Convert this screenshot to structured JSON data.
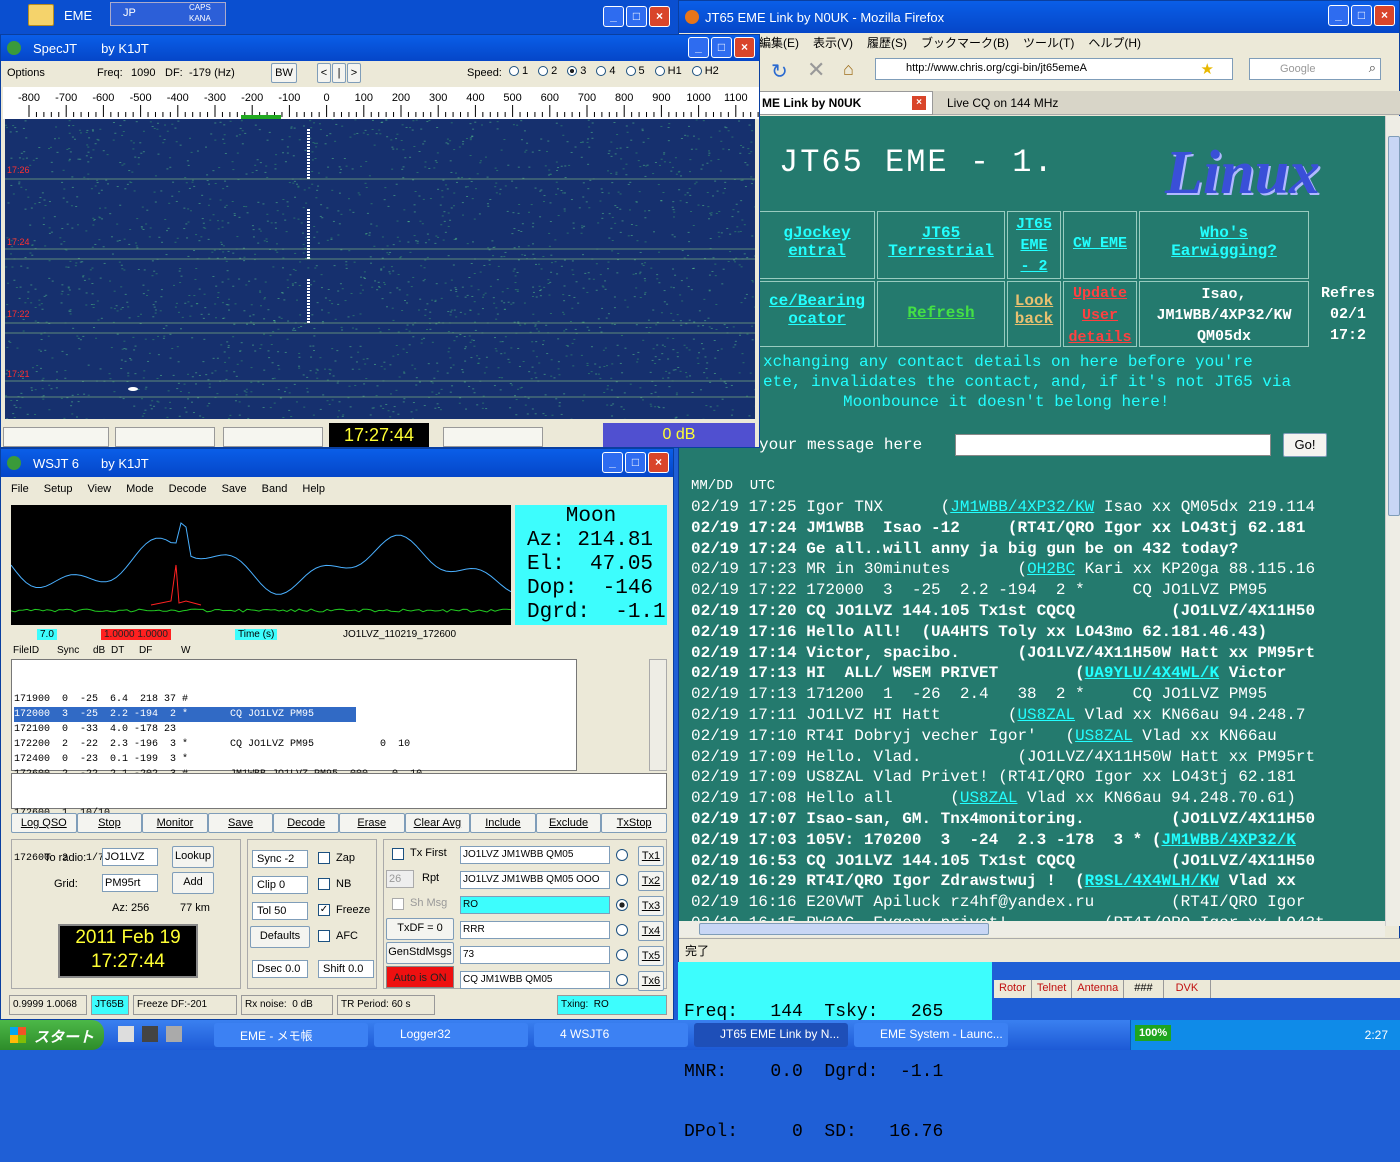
{
  "eme": {
    "title": "EME",
    "ime": {
      "lang": "JP",
      "caps": "CAPS",
      "kana": "KANA"
    }
  },
  "spec": {
    "title": "SpecJT",
    "by": "by K1JT",
    "options": "Options",
    "freq_label": "Freq:",
    "freq": "1090",
    "df_label": "DF:",
    "df": "-179 (Hz)",
    "bw": "BW",
    "speed": "Speed:",
    "speed_opts": [
      "1",
      "2",
      "3",
      "4",
      "5",
      "H1",
      "H2"
    ],
    "ticks": [
      "-800",
      "-700",
      "-600",
      "-500",
      "-400",
      "-300",
      "-200",
      "-100",
      "0",
      "100",
      "200",
      "300",
      "400",
      "500",
      "600",
      "700",
      "800",
      "900",
      "1000",
      "1100"
    ],
    "time_marks": [
      "17:26",
      "17:24",
      "17:22",
      "17:21"
    ],
    "clock": "17:27:44",
    "db": "0 dB"
  },
  "wsjt": {
    "title": "WSJT 6",
    "by": "by K1JT",
    "menu": [
      "File",
      "Setup",
      "View",
      "Mode",
      "Decode",
      "Save",
      "Band",
      "Help"
    ],
    "moon": {
      "title": "Moon",
      "az": "Az: 214.81",
      "el": "El:  47.05",
      "dop": "Dop:  -146",
      "dgrd": "Dgrd:  -1.1"
    },
    "status1": {
      "a": "7.0",
      "b": "1.0000  1.0000",
      "c": "Time (s)",
      "file": "JO1LVZ_110219_172600"
    },
    "headers": [
      "FileID",
      "Sync",
      "dB",
      "DT",
      "DF",
      "W"
    ],
    "rows": [
      "171900  0  -25  6.4  218 37 #",
      "172000  3  -25  2.2 -194  2 *       CQ JO1LVZ PM95           0  10",
      "172100  0  -33  4.0 -178 23",
      "172200  2  -22  2.3 -196  3 *       CQ JO1LVZ PM95           0  10",
      "172400  0  -23  0.1 -199  3 *",
      "172600  2  -22  2.1 -202  3 #       JM1WBB JO1LVZ PM95  000    0  10"
    ],
    "avg": [
      "172600  1  10/10",
      "172600  2   1/7"
    ],
    "buttons": [
      "Log QSO",
      "Stop",
      "Monitor",
      "Save",
      "Decode",
      "Erase",
      "Clear Avg",
      "Include",
      "Exclude",
      "TxStop"
    ],
    "to_radio_label": "To radio:",
    "to_radio": "JO1LVZ",
    "lookup": "Lookup",
    "grid_label": "Grid:",
    "grid": "PM95rt",
    "add": "Add",
    "az": "Az: 256",
    "km": "77 km",
    "date": "2011 Feb 19",
    "time": "17:27:44",
    "sync": "Sync  -2",
    "clip": "Clip  0",
    "tol": "Tol   50",
    "defaults": "Defaults",
    "dsec": "Dsec  0.0",
    "shift": "Shift 0.0",
    "zap": "Zap",
    "nb": "NB",
    "freeze": "Freeze",
    "afc": "AFC",
    "txfirst": "Tx First",
    "rpt_val": "26",
    "rpt": "Rpt",
    "shmsg": "Sh Msg",
    "txdf": "TxDF = 0",
    "genstd": "GenStdMsgs",
    "autoon": "Auto is ON",
    "tx": [
      "JO1LVZ JM1WBB QM05",
      "JO1LVZ JM1WBB QM05 OOO",
      "RO",
      "RRR",
      "73",
      "CQ JM1WBB QM05"
    ],
    "txlabels": [
      "Tx1",
      "Tx2",
      "Tx3",
      "Tx4",
      "Tx5",
      "Tx6"
    ],
    "bottom": [
      "0.9999 1.0068",
      "JT65B",
      "Freeze DF:-201",
      "Rx noise:  0 dB",
      "TR Period: 60 s",
      "Txing:  RO"
    ]
  },
  "ff": {
    "title": "JT65 EME Link by N0UK - Mozilla Firefox",
    "menu": [
      "編集(E)",
      "表示(V)",
      "履歴(S)",
      "ブックマーク(B)",
      "ツール(T)",
      "ヘルプ(H)"
    ],
    "url": "http://www.chris.org/cgi-bin/jt65emeA",
    "search": "Google",
    "tab1": "ME Link by N0UK",
    "tab2": "Live CQ on 144 MHz",
    "heading": "JT65 EME - 1.",
    "logo": "Linux",
    "nav1": [
      "gJockey\nentral",
      "JT65\nTerrestrial",
      "JT65\nEME\n- 2",
      "CW EME",
      "Who's\nEarwigging?"
    ],
    "nav2": [
      "ce/Bearing\nocator",
      "Refresh",
      "Look\nback",
      "Update\nUser\ndetails"
    ],
    "user": "Isao,\nJM1WBB/4XP32/KW\nQM05dx",
    "refresh": "Refres\n02/1\n17:2",
    "warn1": "xchanging any contact details on here before you're",
    "warn2": "ete, invalidates the contact, and, if it's not JT65 via",
    "warn3": "Moonbounce it doesn't belong here!",
    "msg_label": "your message here",
    "go": "Go!",
    "col_header": "MM/DD  UTC",
    "log": [
      [
        "02/19 17:25 Igor TNX      (",
        "JM1WBB/4XP32/KW",
        " Isao xx QM05dx 219.114"
      ],
      [
        "02/19 17:24 JM1WBB  Isao -12     (RT4I/QRO Igor xx LO43tj 62.181",
        "",
        ""
      ],
      [
        "02/19 17:24 Ge all..will anny ja big gun be on 432 today?",
        "",
        ""
      ],
      [
        "02/19 17:23 MR in 30minutes       (",
        "OH2BC",
        " Kari xx KP20ga 88.115.16"
      ],
      [
        "02/19 17:22 172000  3  -25  2.2 -194  2 *     CQ JO1LVZ PM95",
        "",
        ""
      ],
      [
        "02/19 17:20 CQ JO1LVZ 144.105 Tx1st CQCQ          (JO1LVZ/4X11H50",
        "",
        ""
      ],
      [
        "02/19 17:16 Hello All!  (UA4HTS Toly xx LO43mo 62.181.46.43)",
        "",
        ""
      ],
      [
        "02/19 17:14 Victor, spacibo.      (JO1LVZ/4X11H50W Hatt xx PM95rt",
        "",
        ""
      ],
      [
        "02/19 17:13 HI  ALL/ WSEM PRIVET        (",
        "UA9YLU/4X4WL/K",
        " Victor"
      ],
      [
        "02/19 17:13 171200  1  -26  2.4   38  2 *     CQ JO1LVZ PM95",
        "",
        ""
      ],
      [
        "02/19 17:11 JO1LVZ HI Hatt       (",
        "US8ZAL",
        " Vlad xx KN66au 94.248.7"
      ],
      [
        "02/19 17:10 RT4I Dobryj vecher Igor'   (",
        "US8ZAL",
        " Vlad xx KN66au"
      ],
      [
        "02/19 17:09 Hello. Vlad.          (JO1LVZ/4X11H50W Hatt xx PM95rt",
        "",
        ""
      ],
      [
        "02/19 17:09 US8ZAL Vlad Privet! (RT4I/QRO Igor xx LO43tj 62.181",
        "",
        ""
      ],
      [
        "02/19 17:08 Hello all      (",
        "US8ZAL",
        " Vlad xx KN66au 94.248.70.61)"
      ],
      [
        "02/19 17:07 Isao-san, GM. Tnx4monitoring.         (JO1LVZ/4X11H50",
        "",
        ""
      ],
      [
        "02/19 17:03 105V: 170200  3  -24  2.3 -178  3 * (",
        "JM1WBB/4XP32/K",
        ""
      ],
      [
        "02/19 16:53 CQ JO1LVZ 144.105 Tx1st CQCQ          (JO1LVZ/4X11H50",
        "",
        ""
      ],
      [
        "02/19 16:29 RT4I/QRO Igor Zdrawstwuj !  (",
        "R9SL/4X4WLH/KW",
        " Vlad xx"
      ],
      [
        "02/19 16:16 E20VWT Apiluck rz4hf@yandex.ru        (RT4I/QRO Igor",
        "",
        ""
      ],
      [
        "02/19 16:15 RW3AC  Evgeny privet!          (RT4I/QRO Igor xx LO43t",
        "",
        ""
      ]
    ],
    "bold_rows": [
      1,
      2,
      5,
      6,
      7,
      8,
      15,
      16,
      17,
      18
    ],
    "status": "完了"
  },
  "eme_status": {
    "freq": "Freq:   144  Tsky:   265",
    "mnr": "MNR:    0.0  Dgrd:  -1.1",
    "dpol": "DPol:     0  SD:   16.76"
  },
  "logger_tabs": [
    "Rotor",
    "Telnet",
    "Antenna",
    "###",
    "DVK"
  ],
  "taskbar": {
    "start": "スタート",
    "items": [
      "EME - メモ帳",
      "Logger32",
      "4 WSJT6",
      "JT65 EME Link by N...",
      "EME System - Launc..."
    ],
    "zoom": "100%",
    "clock": "2:27"
  }
}
